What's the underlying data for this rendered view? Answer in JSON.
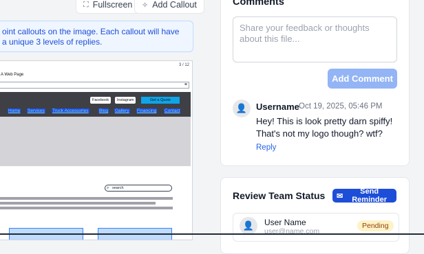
{
  "toolbar": {
    "fullscreen_label": "Fullscreen",
    "add_callout_label": "Add Callout"
  },
  "info_banner": {
    "text": "oint callouts on the image. Each callout will have a unique 3 levels of replies."
  },
  "preview": {
    "page_indicator": "3 / 12",
    "tab_title": "A Web Page",
    "social_links": [
      "Facebook",
      "Instagram"
    ],
    "cta_label": "Get a Quote",
    "nav_links": [
      "Home",
      "Services",
      "Truck Accessories",
      "Blog",
      "Gallery",
      "Financing",
      "Contact"
    ],
    "search_placeholder": "search"
  },
  "comments": {
    "title": "Comments",
    "input_placeholder": "Share your feedback or thoughts about this file...",
    "add_button_label": "Add Comment",
    "items": [
      {
        "username": "Username",
        "timestamp": "Oct 19, 2025, 05:46 PM",
        "text": "Hey! This is look pretty darn spiffy! That's not my logo though? wtf?",
        "reply_label": "Reply"
      }
    ]
  },
  "review_team": {
    "title": "Review Team Status",
    "send_reminder_label": "Send Reminder",
    "members": [
      {
        "name": "User Name",
        "email": "user@name.com",
        "status": "Pending"
      }
    ]
  },
  "colors": {
    "accent": "#1d4ed8",
    "accent_disabled": "#93b4f5",
    "info_bg": "#eff6ff",
    "pending_bg": "#fef3c7"
  },
  "icons": [
    "fullscreen-icon",
    "callout-icon",
    "user-avatar-icon",
    "reminder-icon",
    "hamburger-menu-icon",
    "search-icon"
  ]
}
